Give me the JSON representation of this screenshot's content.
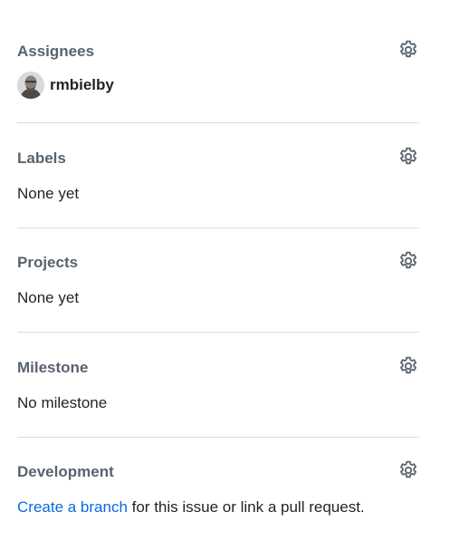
{
  "assignees": {
    "title": "Assignees",
    "users": [
      {
        "login": "rmbielby"
      }
    ]
  },
  "labels": {
    "title": "Labels",
    "value": "None yet"
  },
  "projects": {
    "title": "Projects",
    "value": "None yet"
  },
  "milestone": {
    "title": "Milestone",
    "value": "No milestone"
  },
  "development": {
    "title": "Development",
    "link_text": "Create a branch",
    "rest_text": " for this issue or link a pull request."
  },
  "icons": {
    "settings": "gear-icon"
  },
  "colors": {
    "heading": "#59636e",
    "text": "#1f2328",
    "link": "#0969da",
    "divider": "#d8dee4"
  }
}
